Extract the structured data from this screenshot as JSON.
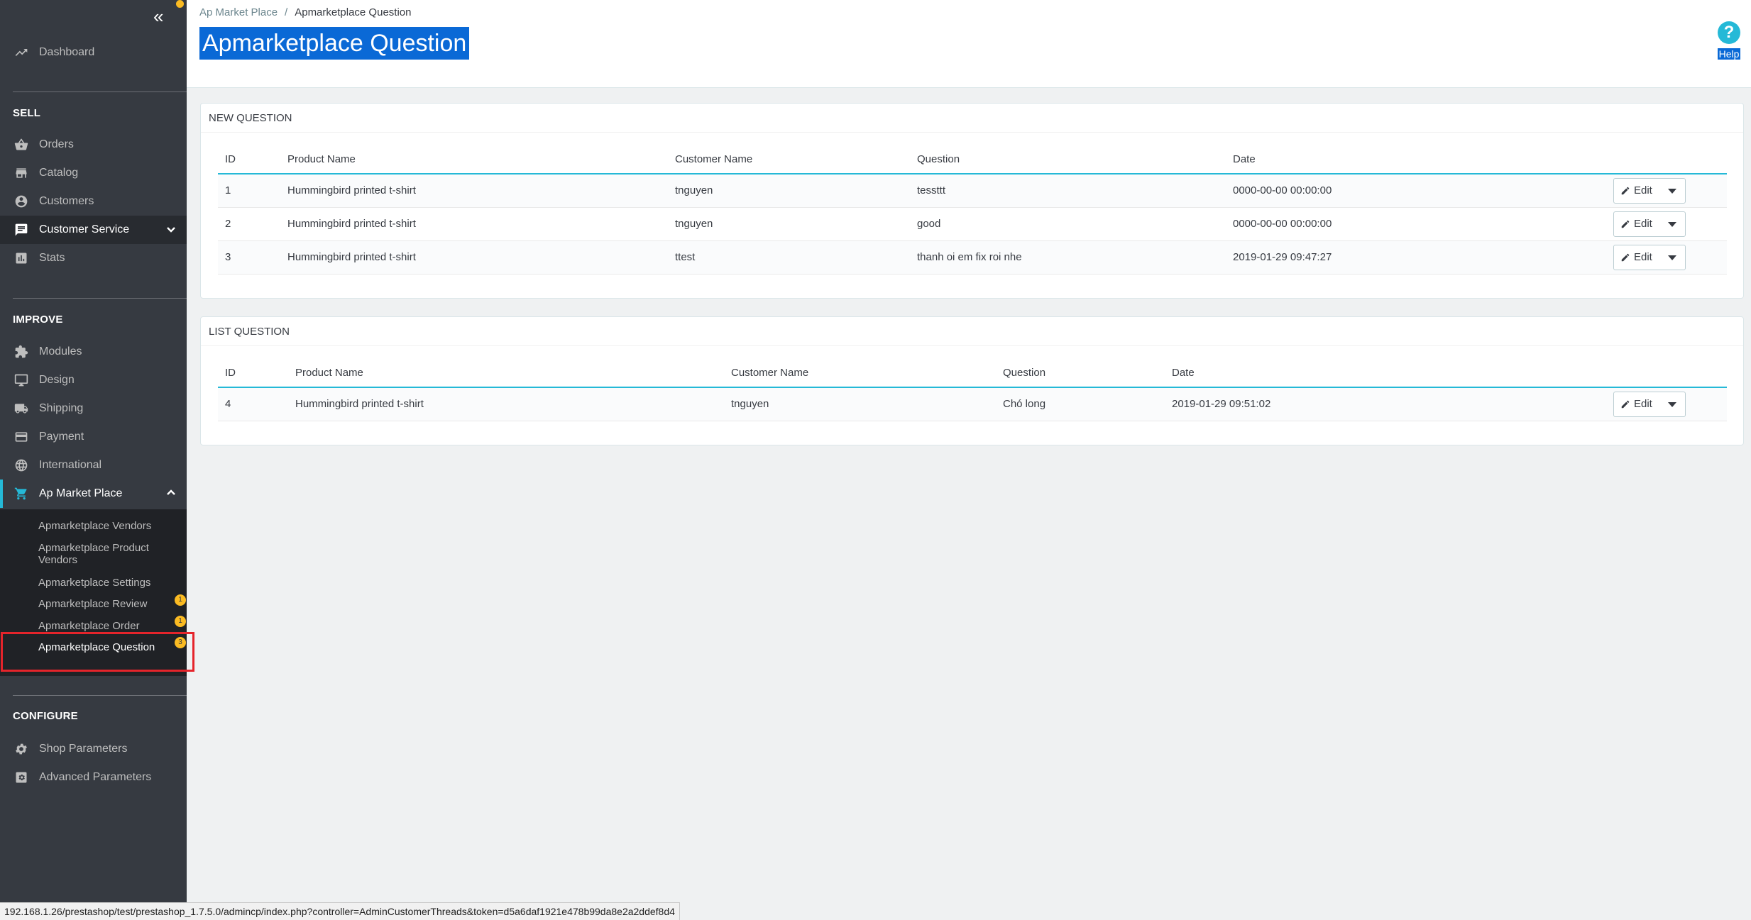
{
  "sidebar": {
    "dashboard": "Dashboard",
    "sections": {
      "sell": "SELL",
      "improve": "IMPROVE",
      "configure": "CONFIGURE"
    },
    "sell_items": [
      "Orders",
      "Catalog",
      "Customers",
      "Customer Service",
      "Stats"
    ],
    "improve_items": [
      "Modules",
      "Design",
      "Shipping",
      "Payment",
      "International",
      "Ap Market Place"
    ],
    "submenu": [
      "Apmarketplace Vendors",
      "Apmarketplace Product Vendors",
      "Apmarketplace Settings",
      "Apmarketplace Review",
      "Apmarketplace Order",
      "Apmarketplace Question"
    ],
    "submenu_badges": [
      "1",
      "1",
      "3"
    ],
    "configure_items": [
      "Shop Parameters",
      "Advanced Parameters"
    ],
    "accent_color": "#25b9d7"
  },
  "header": {
    "breadcrumb_parent": "Ap Market Place",
    "breadcrumb_separator": "/",
    "breadcrumb_current": "Apmarketplace Question",
    "title": "Apmarketplace Question",
    "help_label": "Help",
    "help_icon_glyph": "?"
  },
  "new_question": {
    "heading": "NEW QUESTION",
    "columns": [
      "ID",
      "Product Name",
      "Customer Name",
      "Question",
      "Date"
    ],
    "rows": [
      {
        "id": "1",
        "product": "Hummingbird printed t-shirt",
        "customer": "tnguyen",
        "question": "tessttt",
        "date": "0000-00-00 00:00:00"
      },
      {
        "id": "2",
        "product": "Hummingbird printed t-shirt",
        "customer": "tnguyen",
        "question": "good",
        "date": "0000-00-00 00:00:00"
      },
      {
        "id": "3",
        "product": "Hummingbird printed t-shirt",
        "customer": "ttest",
        "question": "thanh oi em fix roi nhe",
        "date": "2019-01-29 09:47:27"
      }
    ]
  },
  "list_question": {
    "heading": "LIST QUESTION",
    "columns": [
      "ID",
      "Product Name",
      "Customer Name",
      "Question",
      "Date"
    ],
    "rows": [
      {
        "id": "4",
        "product": "Hummingbird printed t-shirt",
        "customer": "tnguyen",
        "question": "Chó long",
        "date": "2019-01-29 09:51:02"
      }
    ]
  },
  "actions": {
    "edit_label": "Edit"
  },
  "statusbar": {
    "url": "192.168.1.26/prestashop/test/prestashop_1.7.5.0/admincp/index.php?controller=AdminCustomerThreads&token=d5a6daf1921e478b99da8e2a2ddef8d4"
  }
}
